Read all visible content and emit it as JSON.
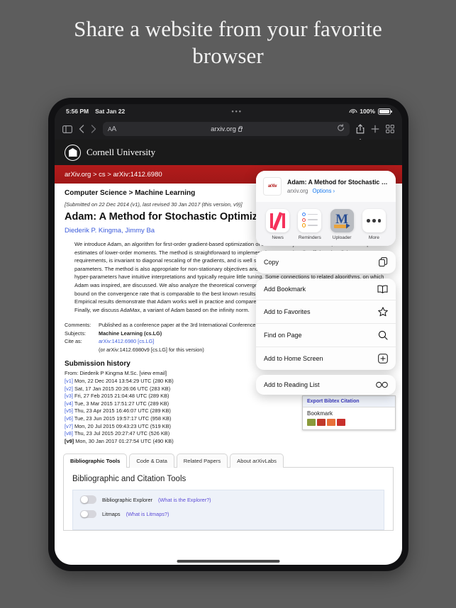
{
  "headline": "Share a website from your favorite browser",
  "statusbar": {
    "time": "5:56 PM",
    "date": "Sat Jan 22",
    "dots": "•••",
    "battery_pct": "100%",
    "wifi_icon": "wifi-icon",
    "battery_icon": "battery-icon"
  },
  "toolbar": {
    "sidebar_icon": "sidebar-icon",
    "back_icon": "chevron-left-icon",
    "forward_icon": "chevron-right-icon",
    "aa_small": "A",
    "aa_big": "A",
    "url": "arxiv.org",
    "lock_icon": "lock-icon",
    "reload_icon": "reload-icon",
    "share_icon": "share-icon",
    "new_tab_icon": "plus-icon",
    "tabs_icon": "grid-tabs-icon"
  },
  "page": {
    "university": "Cornell University",
    "seal_icon": "cornell-seal-icon",
    "breadcrumb_banner": "arXiv.org > cs > arXiv:1412.6980",
    "section": "Computer Science > Machine Learning",
    "submitted": "[Submitted on 22 Dec 2014 (v1), last revised 30 Jan 2017 (this version, v9)]",
    "submitted_v1": "v1",
    "title": "Adam: A Method for Stochastic Optimization",
    "authors": "Diederik P. Kingma, Jimmy Ba",
    "abstract": "We introduce Adam, an algorithm for first-order gradient-based optimization of stochastic objective functions, based on adaptive estimates of lower-order moments. The method is straightforward to implement, is computationally efficient, has little memory requirements, is invariant to diagonal rescaling of the gradients, and is well suited for problems that are large in terms of data and/or parameters. The method is also appropriate for non-stationary objectives and problems with very noisy and/or sparse gradients. The hyper-parameters have intuitive interpretations and typically require little tuning. Some connections to related algorithms, on which Adam was inspired, are discussed. We also analyze the theoretical convergence properties of the algorithm and provide a regret bound on the convergence rate that is comparable to the best known results under the online convex optimization framework. Empirical results demonstrate that Adam works well in practice and compares favorably to other stochastic optimization methods. Finally, we discuss AdaMax, a variant of Adam based on the infinity norm.",
    "meta": [
      {
        "key": "Comments:",
        "value": "Published as a conference paper at the 3rd International Conference for Learning Representations, San Diego, 2015"
      },
      {
        "key": "Subjects:",
        "value": "Machine Learning (cs.LG)"
      },
      {
        "key": "Cite as:",
        "value": "arXiv:1412.6980 [cs.LG]"
      },
      {
        "key": "",
        "value": "(or arXiv:1412.6980v9 [cs.LG] for this version)"
      }
    ],
    "submission_history_title": "Submission history",
    "submission_from": "From: Diederik P Kingma M.Sc. [view email]",
    "submission_from_link": "view email",
    "versions": [
      {
        "v": "[v1]",
        "text": "Mon, 22 Dec 2014 13:54:29 UTC (280 KB)",
        "current": false
      },
      {
        "v": "[v2]",
        "text": "Sat, 17 Jan 2015 20:26:06 UTC (283 KB)",
        "current": false
      },
      {
        "v": "[v3]",
        "text": "Fri, 27 Feb 2015 21:04:48 UTC (289 KB)",
        "current": false
      },
      {
        "v": "[v4]",
        "text": "Tue, 3 Mar 2015 17:51:27 UTC (289 KB)",
        "current": false
      },
      {
        "v": "[v5]",
        "text": "Thu, 23 Apr 2015 16:46:07 UTC (289 KB)",
        "current": false
      },
      {
        "v": "[v6]",
        "text": "Tue, 23 Jun 2015 19:57:17 UTC (958 KB)",
        "current": false
      },
      {
        "v": "[v7]",
        "text": "Mon, 20 Jul 2015 09:43:23 UTC (519 KB)",
        "current": false
      },
      {
        "v": "[v8]",
        "text": "Thu, 23 Jul 2015 20:27:47 UTC (526 KB)",
        "current": false
      },
      {
        "v": "[v9]",
        "text": "Mon, 30 Jan 2017 01:27:54 UTC (490 KB)",
        "current": true
      }
    ],
    "labs_tabs": [
      {
        "label": "Bibliographic Tools",
        "active": true
      },
      {
        "label": "Code & Data",
        "active": false
      },
      {
        "label": "Related Papers",
        "active": false
      },
      {
        "label": "About arXivLabs",
        "active": false
      }
    ],
    "labs_heading": "Bibliographic and Citation Tools",
    "labs_toggles": [
      {
        "label": "Bibliographic Explorer",
        "link": "(What is the Explorer?)"
      },
      {
        "label": "Litmaps",
        "link": "(What is Litmaps?)"
      }
    ]
  },
  "bibtex_popup": {
    "header": "Export Bibtex Citation",
    "body": "Bookmark",
    "icon_colors": [
      "#8a9a3b",
      "#c0392b",
      "#e8703a",
      "#c8302c"
    ]
  },
  "share_sheet": {
    "favicon_text": "arXiv",
    "title": "Adam: A Method for Stochastic Optimiz...",
    "domain": "arxiv.org",
    "options": "Options ›",
    "apps": [
      {
        "name": "News",
        "icon": "news-app-icon"
      },
      {
        "name": "Reminders",
        "icon": "reminders-app-icon"
      },
      {
        "name": "Uploader",
        "icon": "uploader-app-icon"
      },
      {
        "name": "More",
        "icon": "more-dots-icon"
      }
    ],
    "menu_groups": [
      [
        {
          "label": "Copy",
          "icon": "copy-icon"
        }
      ],
      [
        {
          "label": "Add Bookmark",
          "icon": "book-icon"
        },
        {
          "label": "Add to Favorites",
          "icon": "star-icon"
        },
        {
          "label": "Find on Page",
          "icon": "magnifier-icon"
        },
        {
          "label": "Add to Home Screen",
          "icon": "plus-square-icon"
        }
      ],
      [
        {
          "label": "Add to Reading List",
          "icon": "glasses-icon"
        }
      ]
    ]
  },
  "colors": {
    "arxiv_red": "#b31b1b",
    "link_blue": "#3b5bdb",
    "ios_blue": "#1a7aee",
    "accent_bg": "#5d5d5d"
  }
}
